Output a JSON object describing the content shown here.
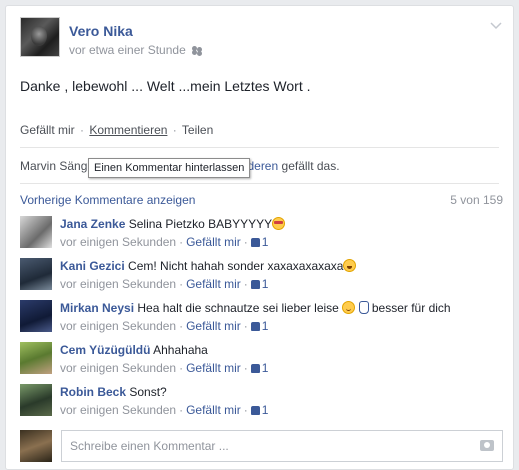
{
  "post": {
    "author": "Vero Nika",
    "time": "vor etwa einer Stunde",
    "text": "Danke , lebewohl ... Welt ...mein Letztes Wort .",
    "audience_icon": "friends-icon",
    "menu_icon": "chevron-down-icon"
  },
  "actions": {
    "like": "Gefällt mir",
    "sep": "·",
    "comment": "Kommentieren",
    "share": "Teilen"
  },
  "likes": {
    "name_partial": "Marvin Säng",
    "mid": "und",
    "others": "38 anderen",
    "suffix": "gefällt das."
  },
  "tooltip": "Einen Kommentar hinterlassen",
  "comments_header": {
    "previous": "Vorherige Kommentare anzeigen",
    "count": "5 von 159"
  },
  "comments": [
    {
      "name": "Jana Zenke",
      "text": "Selina Pietzko BABYYYYY",
      "emoji": "glasses",
      "time": "vor einigen Sekunden",
      "like": "Gefällt mir",
      "likes": "1"
    },
    {
      "name": "Kani Gezici",
      "text": "Cem! Nicht hahah sonder xaxaxaxaxaxa",
      "emoji": "laugh",
      "time": "vor einigen Sekunden",
      "like": "Gefällt mir",
      "likes": "1"
    },
    {
      "name": "Mirkan Neysi",
      "text": "Hea halt die schnautze sei lieber leise",
      "text2": "besser für dich",
      "emoji": "smile",
      "time": "vor einigen Sekunden",
      "like": "Gefällt mir",
      "likes": "1"
    },
    {
      "name": "Cem Yüzügüldü",
      "text": "Ahhahaha",
      "time": "vor einigen Sekunden",
      "like": "Gefällt mir",
      "likes": "1"
    },
    {
      "name": "Robin Beck",
      "text": "Sonst?",
      "time": "vor einigen Sekunden",
      "like": "Gefällt mir",
      "likes": "1"
    }
  ],
  "composer": {
    "placeholder": "Schreibe einen Kommentar ...",
    "camera_icon": "camera-icon"
  },
  "colors": {
    "link": "#3b5998",
    "muted": "#90949c",
    "border": "#dddfe2"
  }
}
